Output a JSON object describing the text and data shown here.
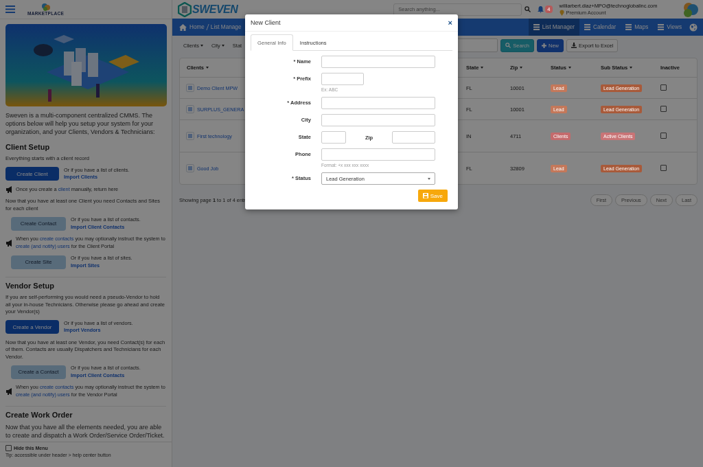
{
  "sidebar": {
    "marketplace_label": "MARKETPLACE",
    "intro": "Sweven is a multi-component centralized CMMS. The options below will help you setup your system for your organization, and your Clients, Vendors & Technicians:",
    "sections": [
      {
        "title": "Client Setup",
        "items": [
          {
            "kind": "text",
            "text": "Everything starts with a client record"
          },
          {
            "kind": "primary_action",
            "button": "Create Client",
            "or_text": "Or if you have a list of clients.",
            "link": "Import Clients"
          },
          {
            "kind": "note",
            "parts": [
              {
                "text": "Once you create a ",
                "link": false
              },
              {
                "text": "client",
                "link": true
              },
              {
                "text": " manually, return here",
                "link": false
              }
            ]
          },
          {
            "kind": "text",
            "text": "Now that you have at least one Client you need Contacts and Sites for each client"
          },
          {
            "kind": "secondary_action",
            "button": "Create Contact",
            "or_text": "Or if you have a list of contacts.",
            "link": "Import Client Contacts"
          },
          {
            "kind": "note",
            "parts": [
              {
                "text": "When you ",
                "link": false
              },
              {
                "text": "create contacts",
                "link": true
              },
              {
                "text": " you may optionally instruct the system to ",
                "link": false
              },
              {
                "text": "create (and notify) users",
                "link": true
              },
              {
                "text": " for the Client Portal",
                "link": false
              }
            ]
          },
          {
            "kind": "secondary_action",
            "button": "Create Site",
            "or_text": "Or if you have a list of sites.",
            "link": "Import Sites"
          }
        ]
      },
      {
        "title": "Vendor Setup",
        "items": [
          {
            "kind": "text",
            "text": "If you are self-performing you would need a pseudo-Vendor to hold all your in-house Technicians. Otherwise please go ahead and create your Vendor(s)"
          },
          {
            "kind": "primary_action",
            "button": "Create a Vendor",
            "or_text": "Or if you have a list of vendors.",
            "link": "Import Vendors"
          },
          {
            "kind": "text",
            "text": "Now that you have at least one Vendor, you need Contact(s) for each of them. Contacts are usually Dispatchers and Technicians for each Vendor."
          },
          {
            "kind": "secondary_action",
            "button": "Create a Contact",
            "or_text": "Or if you have a list of contacts.",
            "link": "Import Client Contacts"
          },
          {
            "kind": "note",
            "parts": [
              {
                "text": "When you ",
                "link": false
              },
              {
                "text": "create contacts",
                "link": true
              },
              {
                "text": " you may optionally instruct the system to ",
                "link": false
              },
              {
                "text": "create (and notify) users",
                "link": true
              },
              {
                "text": " for the Vendor Portal",
                "link": false
              }
            ]
          }
        ]
      },
      {
        "title": "Create Work Order",
        "items": [
          {
            "kind": "lead",
            "text": "Now that you have all the elements needed, you are able to create and dispatch a Work Order/Service Order/Ticket."
          }
        ]
      }
    ],
    "hide_menu": {
      "label": "Hide this Menu",
      "checked": false
    },
    "tip": "Tip: accessible under header > help center button"
  },
  "header": {
    "logo": "SWEVEN",
    "search": {
      "placeholder": "Search anything..."
    },
    "notifications": "4",
    "user_email": "williarbert.diaz+MPO@technoglobalinc.com",
    "account": "Premium Account"
  },
  "breadcrumb": [
    "Home",
    "List Manage"
  ],
  "nav": [
    {
      "label": "List Manager",
      "selected": true
    },
    {
      "label": "Calendar",
      "selected": false
    },
    {
      "label": "Maps",
      "selected": false
    },
    {
      "label": "Views",
      "selected": false
    }
  ],
  "filters": [
    {
      "label": "Clients",
      "caret": true
    },
    {
      "label": "City",
      "caret": true
    },
    {
      "label": "Stat",
      "caret": false
    }
  ],
  "toolbar": {
    "search_button": "Search",
    "new_button": "New",
    "export_button": "Export to Excel"
  },
  "table": {
    "columns": [
      "Clients",
      "State",
      "Zip",
      "Status",
      "Sub Status",
      "Inactive"
    ],
    "rows": [
      {
        "client": "Demo Client MPW",
        "state": "FL",
        "zip": "10001",
        "status": {
          "label": "Lead",
          "color": "#c4785a"
        },
        "sub_status": {
          "label": "Lead Generation",
          "color": "#a85a3a"
        },
        "inactive": false
      },
      {
        "client": "SURPLUS_GENERA",
        "state": "FL",
        "zip": "10001",
        "status": {
          "label": "Lead",
          "color": "#c4785a"
        },
        "sub_status": {
          "label": "Lead Generation",
          "color": "#a85a3a"
        },
        "inactive": false
      },
      {
        "client": "First technology",
        "state": "IN",
        "zip": "4711",
        "status": {
          "label": "Clients",
          "color": "#c46a6c"
        },
        "sub_status": {
          "label": "Active Clients",
          "color": "#c97476"
        },
        "inactive": false
      },
      {
        "client": "Good Job",
        "state": "FL",
        "zip": "32809",
        "status": {
          "label": "Lead",
          "color": "#c4785a"
        },
        "sub_status": {
          "label": "Lead Generation",
          "color": "#a85a3a"
        },
        "inactive": false
      }
    ]
  },
  "pagination": {
    "summary": "Showing page **1** to 1 of 4 entr",
    "buttons": [
      "First",
      "Previous",
      "Next",
      "Last"
    ]
  },
  "modal": {
    "title": "New Client",
    "close": "×",
    "tabs": [
      {
        "label": "General Info",
        "selected": true
      },
      {
        "label": "Instructions",
        "selected": false
      }
    ],
    "fields": [
      {
        "kind": "text",
        "label": "* Name"
      },
      {
        "kind": "short",
        "label": "* Prefix",
        "hint": "Ex: ABC"
      },
      {
        "kind": "text",
        "label": "* Address"
      },
      {
        "kind": "text",
        "label": "City"
      },
      {
        "kind": "pair",
        "items": [
          {
            "label": "State"
          },
          {
            "label": "Zip"
          }
        ]
      },
      {
        "kind": "text",
        "label": "Phone",
        "hint": "Format: +x xxx xxx xxxx"
      },
      {
        "kind": "select",
        "label": "* Status",
        "value": "Lead Generation"
      }
    ],
    "save": "Save"
  }
}
